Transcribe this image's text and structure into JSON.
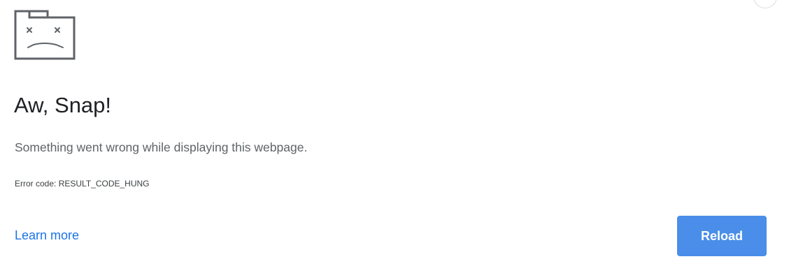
{
  "page": {
    "heading": "Aw, Snap!",
    "message": "Something went wrong while displaying this webpage.",
    "error_code": "Error code: RESULT_CODE_HUNG",
    "learn_more_label": "Learn more",
    "reload_label": "Reload"
  },
  "icons": {
    "sad_tab": "sad-tab-icon"
  },
  "colors": {
    "heading": "#202124",
    "message": "#5f6368",
    "link": "#1a73e8",
    "button_background": "#4a8ee9",
    "button_text": "#ffffff",
    "icon_stroke": "#5f6368"
  }
}
